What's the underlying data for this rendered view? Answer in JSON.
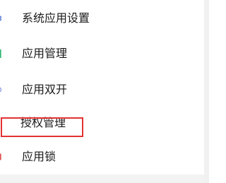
{
  "settings_list": {
    "items": [
      {
        "label": "系统应用设置",
        "icon": "apps-icon"
      },
      {
        "label": "应用管理",
        "icon": "app-manage-icon"
      },
      {
        "label": "应用双开",
        "icon": "app-clone-icon"
      },
      {
        "label": "授权管理",
        "icon": "permission-icon"
      },
      {
        "label": "应用锁",
        "icon": "app-lock-icon"
      }
    ]
  },
  "highlight": {
    "target": "授权管理",
    "color": "#e23232"
  },
  "colors": {
    "icon_1": "#4a6fd1",
    "icon_2": "#2bb673",
    "icon_3": "#6b82d6",
    "icon_5": "#e04a4a"
  }
}
